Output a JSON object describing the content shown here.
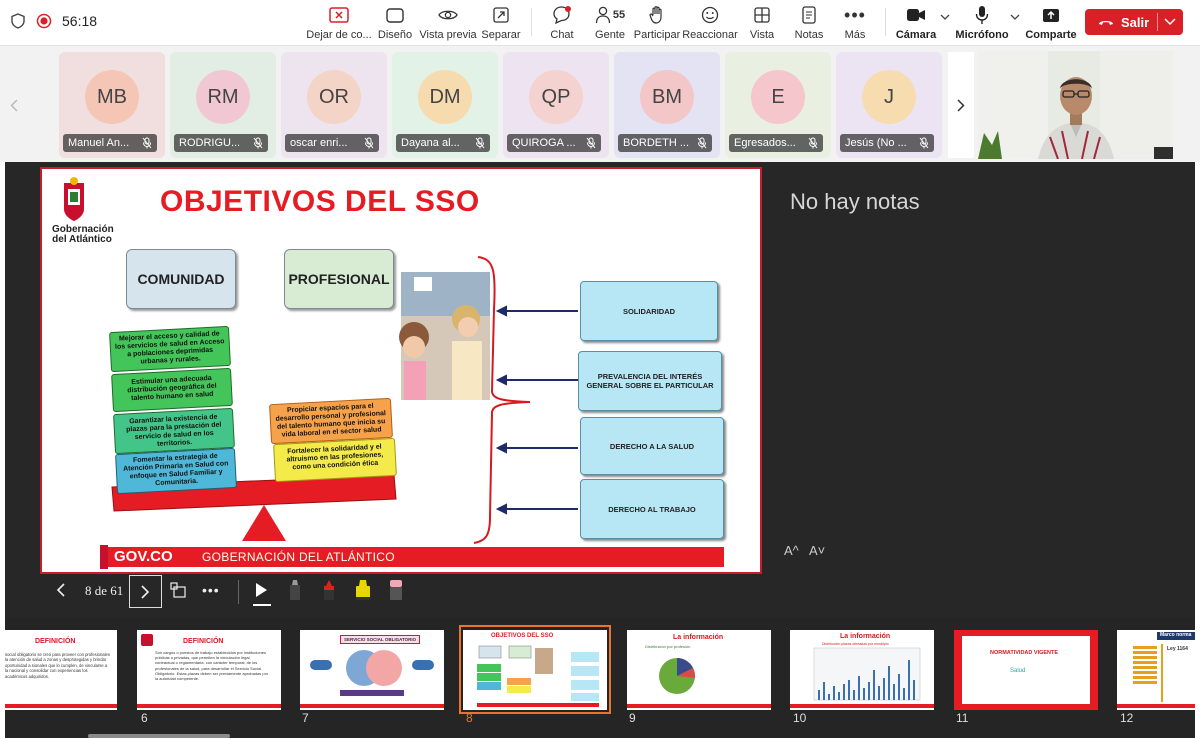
{
  "toolbar": {
    "timer": "56:18",
    "buttons": [
      {
        "label": "Dejar de co..."
      },
      {
        "label": "Diseño"
      },
      {
        "label": "Vista previa"
      },
      {
        "label": "Separar"
      },
      {
        "label": "Chat"
      },
      {
        "label": "Gente",
        "count": "55"
      },
      {
        "label": "Participar"
      },
      {
        "label": "Reaccionar"
      },
      {
        "label": "Vista"
      },
      {
        "label": "Notas"
      },
      {
        "label": "Más"
      },
      {
        "label": "Cámara"
      },
      {
        "label": "Micrófono"
      },
      {
        "label": "Comparte"
      }
    ],
    "leave_label": "Salir",
    "colors": {
      "leave": "#d92027",
      "stop_share": "#d92027"
    }
  },
  "participants": [
    {
      "initials": "MB",
      "name": "Manuel An...",
      "bg": "#f1dede",
      "avatar": "#f5c6b5"
    },
    {
      "initials": "RM",
      "name": "RODRIGU...",
      "bg": "#e2eee4",
      "avatar": "#f2c7d4"
    },
    {
      "initials": "OR",
      "name": "oscar enri...",
      "bg": "#eee4f0",
      "avatar": "#f4d4c6"
    },
    {
      "initials": "DM",
      "name": "Dayana al...",
      "bg": "#e3f2e6",
      "avatar": "#f6dbaf"
    },
    {
      "initials": "QP",
      "name": "QUIROGA ...",
      "bg": "#eee3f0",
      "avatar": "#f4d2cf"
    },
    {
      "initials": "BM",
      "name": "BORDETH ...",
      "bg": "#e3e3f3",
      "avatar": "#f3c7c7"
    },
    {
      "initials": "E",
      "name": "Egresados...",
      "bg": "#e9f0e1",
      "avatar": "#f5c7cd"
    },
    {
      "initials": "J",
      "name": "Jesús (No ...",
      "bg": "#ece4f3",
      "avatar": "#f6dcae"
    }
  ],
  "presentation": {
    "notes_empty": "No hay notas",
    "font_bigger": "A^",
    "font_smaller": "A˅",
    "page_counter": "8 de 61"
  },
  "slide": {
    "title": "OBJETIVOS DEL SSO",
    "logo_text": "Gobernación del Atlántico",
    "comunidad": "COMUNIDAD",
    "profesional": "PROFESIONAL",
    "green_boxes": [
      "Mejorar el acceso y calidad de los servicios de salud en Acceso a poblaciones deprimidas urbanas y rurales.",
      "Estimular una adecuada distribución geográfica del talento humano en salud",
      "Garantizar la existencia de plazas para la prestación del servicio de salud en los territorios.",
      "Fomentar la estrategia de Atención Primaria en Salud con enfoque en Salud Familiar y Comunitaria."
    ],
    "orange_box": "Propiciar espacios para el desarrollo personal y profesional del talento humano que inicia su vida laboral en el sector salud",
    "yellow_box": "Fortalecer la solidaridad y el altruismo en las profesiones, como una condición ética",
    "values": [
      "SOLIDARIDAD",
      "PREVALENCIA DEL INTERÉS GENERAL SOBRE EL PARTICULAR",
      "DERECHO A LA SALUD",
      "DERECHO AL TRABAJO"
    ],
    "footer_govco": "GOV.CO",
    "footer_text": "GOBERNACIÓN DEL ATLÁNTICO"
  },
  "thumbnails": [
    {
      "num": "",
      "title": "DEFINICIÓN"
    },
    {
      "num": "6",
      "title": "DEFINICIÓN"
    },
    {
      "num": "7",
      "title": "SERVICIO SOCIAL OBLIGATORIO"
    },
    {
      "num": "8",
      "title": "OBJETIVOS DEL SSO",
      "selected": true
    },
    {
      "num": "9",
      "title": "La información"
    },
    {
      "num": "10",
      "title": "La información"
    },
    {
      "num": "11",
      "title": "NORMATIVIDAD VIGENTE"
    },
    {
      "num": "12",
      "title": "Marco norma"
    }
  ],
  "thumb_texts": {
    "p5_a": "social obligatorio se creó para proveer con profesionales la atención de salud a zonas y desprotegidas y brindar oportunidad a",
    "p5_b": "sionales que lo cumplen, de vincularse a la nacional y consolidar con experiencias los académicos adquiridos.",
    "p6": "Son cargos o puestos de trabajo establecidos por instituciones públicas o privadas, que permiten la vinculación legal, contractual o reglamentaria, con carácter temporal, de los profesionales de la salud, para desarrollar el Servicio Social Obligatorio. Estas plazas deben ser previamente aprobadas por la autoridad competente.",
    "p9": "Distribución por profesión",
    "p10": "Distribución plazas ofertadas por municipio",
    "p11_logo": "Salud",
    "p12": "Ley 1164"
  }
}
